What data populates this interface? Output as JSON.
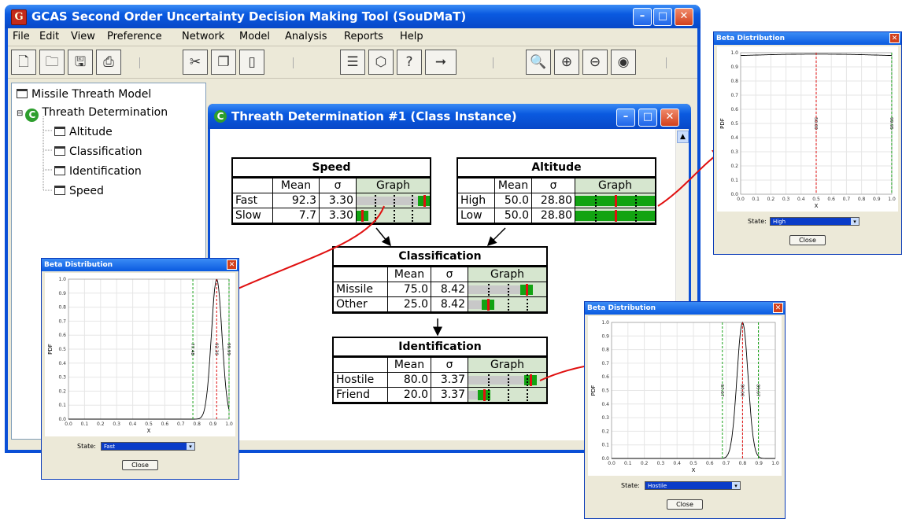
{
  "window": {
    "title": "GCAS Second Order Uncertainty Decision Making Tool (SouDMaT)",
    "icon_letter": "G"
  },
  "menu": [
    "File",
    "Edit",
    "View",
    "Preference",
    "Network",
    "Model",
    "Analysis",
    "Reports",
    "Help"
  ],
  "toolbar_icons": [
    "new-file-icon",
    "open-folder-icon",
    "save-icon",
    "print-icon",
    "cut-icon",
    "copy-icon",
    "paste-icon",
    "properties-icon",
    "node-icon",
    "question-icon",
    "arrow-icon",
    "zoom-icon",
    "zoom-in-icon",
    "zoom-out-icon",
    "zoom-fit-icon"
  ],
  "tree": {
    "root": "Missile Threath Model",
    "class": "Threath Determination",
    "items": [
      "Altitude",
      "Classification",
      "Identification",
      "Speed"
    ]
  },
  "inner_window": {
    "title": "Threath Determination #1 (Class Instance)"
  },
  "col_headers": {
    "mean": "Mean",
    "sigma": "σ",
    "graph": "Graph"
  },
  "nodes": {
    "speed": {
      "title": "Speed",
      "rows": [
        {
          "state": "Fast",
          "mean": "92.3",
          "sigma": "3.30",
          "level": 0.923
        },
        {
          "state": "Slow",
          "mean": "7.7",
          "sigma": "3.30",
          "level": 0.077
        }
      ]
    },
    "altitude": {
      "title": "Altitude",
      "rows": [
        {
          "state": "High",
          "mean": "50.0",
          "sigma": "28.80",
          "level": 0.5
        },
        {
          "state": "Low",
          "mean": "50.0",
          "sigma": "28.80",
          "level": 0.5
        }
      ]
    },
    "classification": {
      "title": "Classification",
      "rows": [
        {
          "state": "Missile",
          "mean": "75.0",
          "sigma": "8.42",
          "level": 0.75
        },
        {
          "state": "Other",
          "mean": "25.0",
          "sigma": "8.42",
          "level": 0.25
        }
      ]
    },
    "identification": {
      "title": "Identification",
      "rows": [
        {
          "state": "Hostile",
          "mean": "80.0",
          "sigma": "3.37",
          "level": 0.8
        },
        {
          "state": "Friend",
          "mean": "20.0",
          "sigma": "3.37",
          "level": 0.2
        }
      ]
    }
  },
  "beta_dialogs": {
    "common": {
      "title": "Beta Distribution",
      "ylabel": "PDF",
      "xlabel": "X",
      "state_label": "State:",
      "close_label": "Close"
    },
    "high": {
      "state": "High",
      "mean_label": "50.00",
      "hi_label": "99.95",
      "mean": 0.5,
      "lo": 0.0,
      "hi": 0.9995,
      "dist": "flat"
    },
    "fast": {
      "state": "Fast",
      "mean_label": "92.30",
      "lo_label": "77.48",
      "hi_label": "99.99",
      "mean": 0.923,
      "lo": 0.7748,
      "hi": 0.9999,
      "dist": "peak",
      "sd": 0.033
    },
    "hostile": {
      "state": "Hostile",
      "mean_label": "80.00",
      "lo_label": "67.67",
      "hi_label": "89.67",
      "mean": 0.8,
      "lo": 0.6767,
      "hi": 0.8967,
      "dist": "peak",
      "sd": 0.0337
    }
  },
  "colors": {
    "window_blue": "#0a4fd6",
    "graph_green": "#12a312",
    "graph_red": "#e01010",
    "header_green": "#d6e6cf"
  }
}
